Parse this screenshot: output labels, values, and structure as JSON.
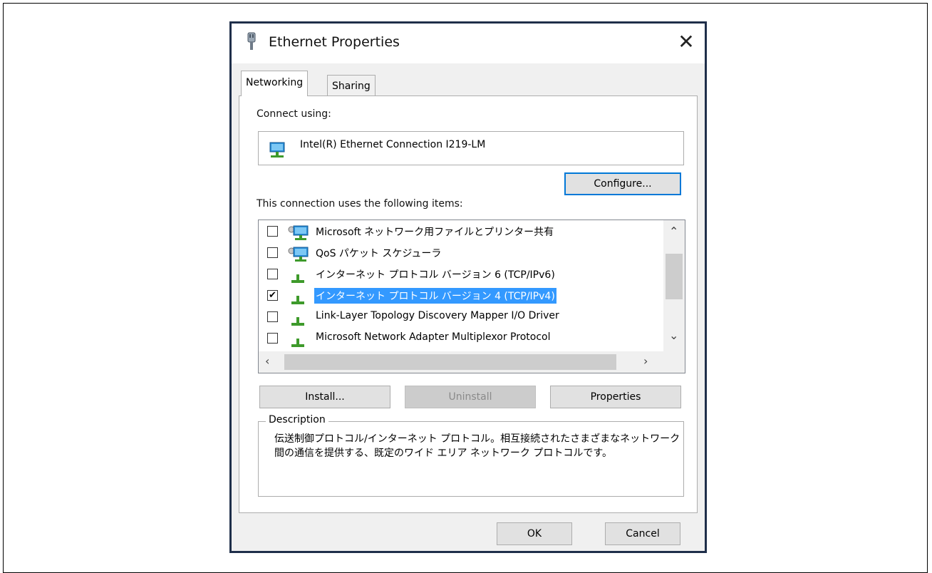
{
  "window": {
    "title": "Ethernet Properties",
    "close_glyph": "✕"
  },
  "tabs": [
    {
      "label": "Networking",
      "active": true
    },
    {
      "label": "Sharing",
      "active": false
    }
  ],
  "connect_using": {
    "label": "Connect using:",
    "adapter": {
      "icon": "network-adapter-icon",
      "name": "Intel(R) Ethernet Connection I219-LM"
    },
    "configure_button": "Configure..."
  },
  "items_section": {
    "label": "This connection uses the following items:",
    "items": [
      {
        "checked": false,
        "icon": "network-service-icon",
        "label": "Microsoft ネットワーク用ファイルとプリンター共有",
        "selected": false
      },
      {
        "checked": false,
        "icon": "network-service-icon",
        "label": "QoS パケット スケジューラ",
        "selected": false
      },
      {
        "checked": false,
        "icon": "protocol-icon",
        "label": "インターネット プロトコル バージョン 6 (TCP/IPv6)",
        "selected": false
      },
      {
        "checked": true,
        "icon": "protocol-icon",
        "label": "インターネット プロトコル バージョン 4 (TCP/IPv4)",
        "selected": true
      },
      {
        "checked": false,
        "icon": "protocol-icon",
        "label": "Link-Layer Topology Discovery Mapper I/O Driver",
        "selected": false
      },
      {
        "checked": false,
        "icon": "protocol-icon",
        "label": "Microsoft Network Adapter Multiplexor Protocol",
        "selected": false
      }
    ]
  },
  "action_buttons": {
    "install": "Install...",
    "uninstall": "Uninstall",
    "properties": "Properties"
  },
  "description": {
    "title": "Description",
    "text": "伝送制御プロトコル/インターネット プロトコル。相互接続されたさまざまなネットワーク間の通信を提供する、既定のワイド エリア ネットワーク プロトコルです。"
  },
  "footer": {
    "ok": "OK",
    "cancel": "Cancel"
  },
  "colors": {
    "selection": "#3399ff",
    "focus_border": "#0078d7",
    "dialog_border": "#1f2f4a"
  }
}
